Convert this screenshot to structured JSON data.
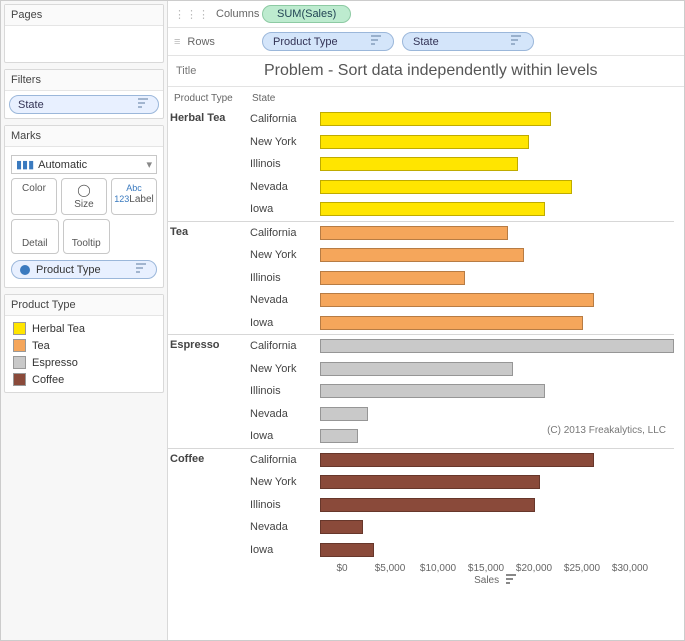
{
  "sidebar": {
    "pages": {
      "title": "Pages"
    },
    "filters": {
      "title": "Filters",
      "pill": "State"
    },
    "marks": {
      "title": "Marks",
      "select": "Automatic",
      "buttons": {
        "color": "Color",
        "size": "Size",
        "label": "Label",
        "detail": "Detail",
        "tooltip": "Tooltip"
      },
      "colorpill": "Product Type"
    },
    "legend": {
      "title": "Product Type",
      "items": [
        {
          "label": "Herbal Tea",
          "color": "#ffe500"
        },
        {
          "label": "Tea",
          "color": "#f5a65b"
        },
        {
          "label": "Espresso",
          "color": "#c9c9c9"
        },
        {
          "label": "Coffee",
          "color": "#8a4a3a"
        }
      ]
    }
  },
  "shelves": {
    "columns": {
      "label": "Columns",
      "field": "SUM(Sales)"
    },
    "rows": {
      "label": "Rows",
      "fields": [
        "Product Type",
        "State"
      ]
    }
  },
  "title": {
    "label": "Title",
    "text": "Problem - Sort data independently within levels"
  },
  "chart_data": {
    "type": "bar",
    "title": "Problem - Sort data independently within levels",
    "xlabel": "Sales",
    "ylabel": "",
    "xlim": [
      0,
      33000
    ],
    "ticks": [
      0,
      5000,
      10000,
      15000,
      20000,
      25000,
      30000
    ],
    "tick_labels": [
      "$0",
      "$5,000",
      "$10,000",
      "$15,000",
      "$20,000",
      "$25,000",
      "$30,000"
    ],
    "headers": {
      "group": "Product Type",
      "sub": "State"
    },
    "credit": "(C) 2013 Freakalytics, LLC",
    "series_colors": {
      "Herbal Tea": "#ffe500",
      "Tea": "#f5a65b",
      "Espresso": "#c9c9c9",
      "Coffee": "#8a4a3a"
    },
    "groups": [
      {
        "name": "Herbal Tea",
        "rows": [
          {
            "state": "California",
            "value": 21500
          },
          {
            "state": "New York",
            "value": 19500
          },
          {
            "state": "Illinois",
            "value": 18500
          },
          {
            "state": "Nevada",
            "value": 23500
          },
          {
            "state": "Iowa",
            "value": 21000
          }
        ]
      },
      {
        "name": "Tea",
        "rows": [
          {
            "state": "California",
            "value": 17500
          },
          {
            "state": "New York",
            "value": 19000
          },
          {
            "state": "Illinois",
            "value": 13500
          },
          {
            "state": "Nevada",
            "value": 25500
          },
          {
            "state": "Iowa",
            "value": 24500
          }
        ]
      },
      {
        "name": "Espresso",
        "rows": [
          {
            "state": "California",
            "value": 33000
          },
          {
            "state": "New York",
            "value": 18000
          },
          {
            "state": "Illinois",
            "value": 21000
          },
          {
            "state": "Nevada",
            "value": 4500
          },
          {
            "state": "Iowa",
            "value": 3500
          }
        ]
      },
      {
        "name": "Coffee",
        "rows": [
          {
            "state": "California",
            "value": 25500
          },
          {
            "state": "New York",
            "value": 20500
          },
          {
            "state": "Illinois",
            "value": 20000
          },
          {
            "state": "Nevada",
            "value": 4000
          },
          {
            "state": "Iowa",
            "value": 5000
          }
        ]
      }
    ]
  }
}
